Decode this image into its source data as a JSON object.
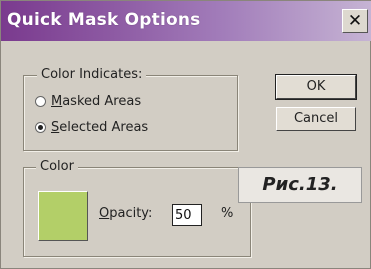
{
  "window": {
    "title": "Quick Mask Options",
    "close_glyph": "✕"
  },
  "color_indicates": {
    "legend": "Color Indicates:",
    "options": [
      {
        "mnemonic": "M",
        "rest": "asked Areas",
        "selected": false
      },
      {
        "mnemonic": "S",
        "rest": "elected Areas",
        "selected": true
      }
    ]
  },
  "buttons": {
    "ok": "OK",
    "cancel": "Cancel"
  },
  "color_group": {
    "legend": "Color",
    "swatch_color": "#b3cf68",
    "opacity_mnemonic": "O",
    "opacity_rest": "pacity:",
    "opacity_value": "50",
    "percent": "%"
  },
  "caption": "Рис.13."
}
